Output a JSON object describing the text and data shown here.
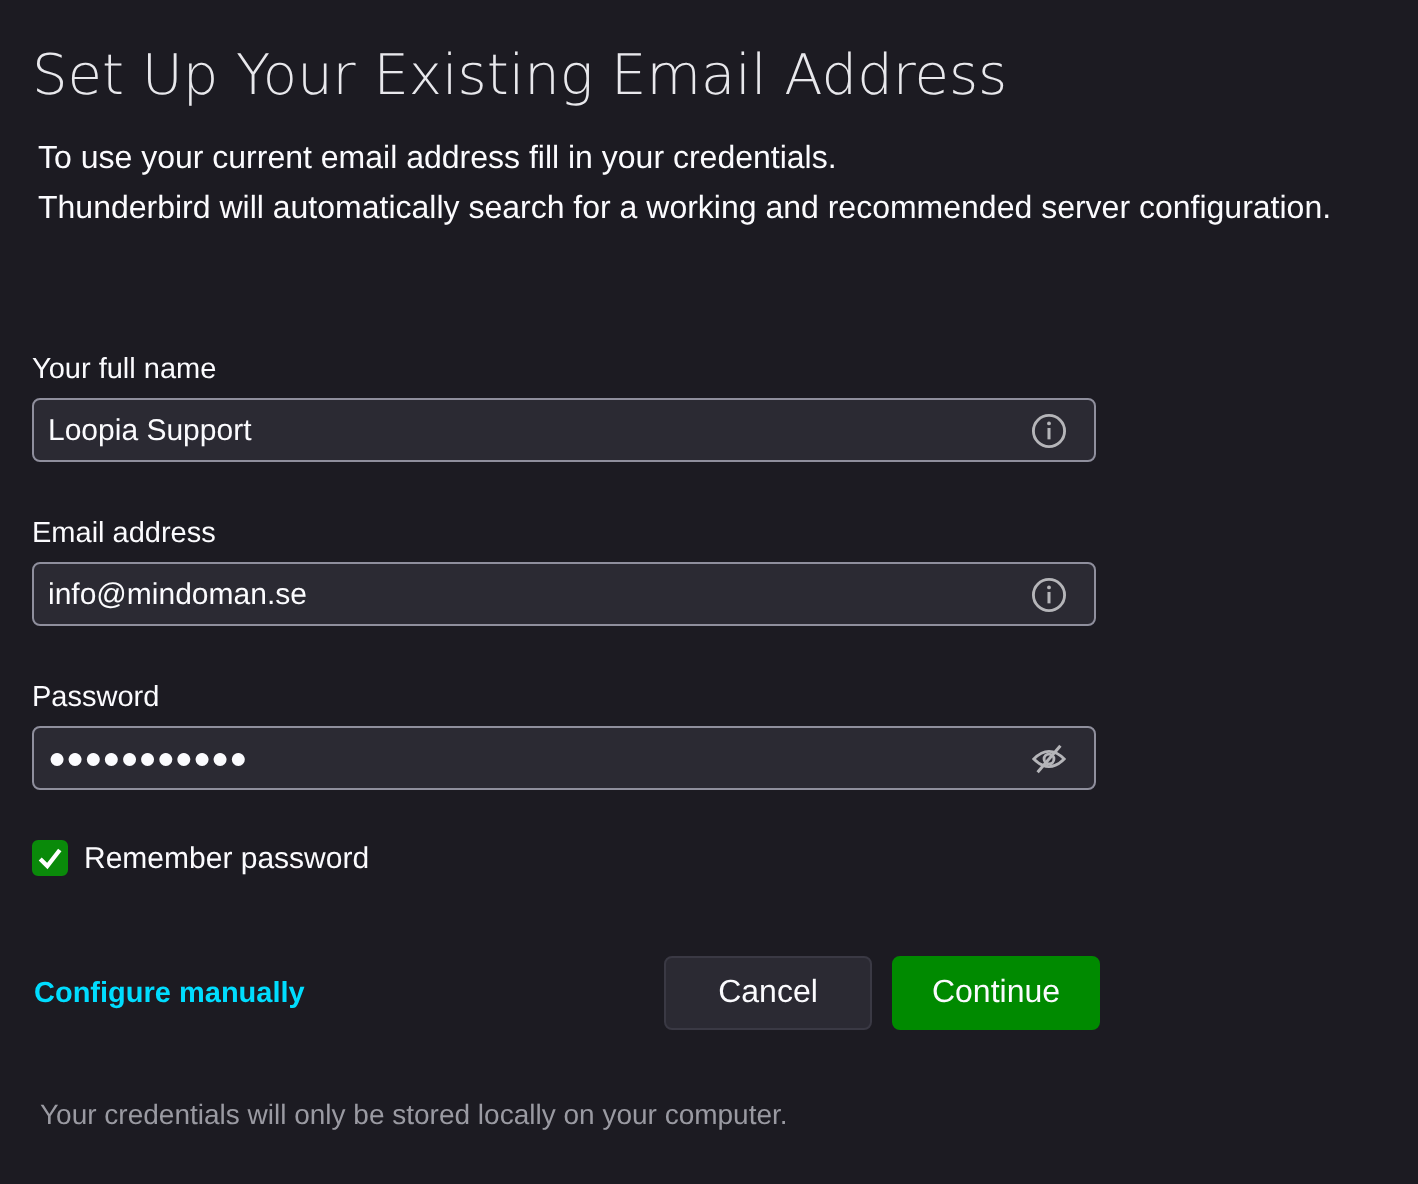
{
  "title": "Set Up Your Existing Email Address",
  "intro": [
    "To use your current email address fill in your credentials.",
    "Thunderbird will automatically search for a working and recommended server configuration."
  ],
  "fields": [
    {
      "label": "Your full name",
      "value": "Loopia Support",
      "kind": "text"
    },
    {
      "label": "Email address",
      "value": "info@mindoman.se",
      "kind": "text"
    },
    {
      "label": "Password",
      "value": "●●●●●●●●●●●",
      "kind": "password"
    }
  ],
  "remember": {
    "label": "Remember password",
    "checked": true
  },
  "link": "Configure manually",
  "buttons": [
    {
      "label": "Cancel",
      "kind": "secondary"
    },
    {
      "label": "Continue",
      "kind": "primary"
    }
  ],
  "footer": "Your credentials will only be stored locally on your computer."
}
